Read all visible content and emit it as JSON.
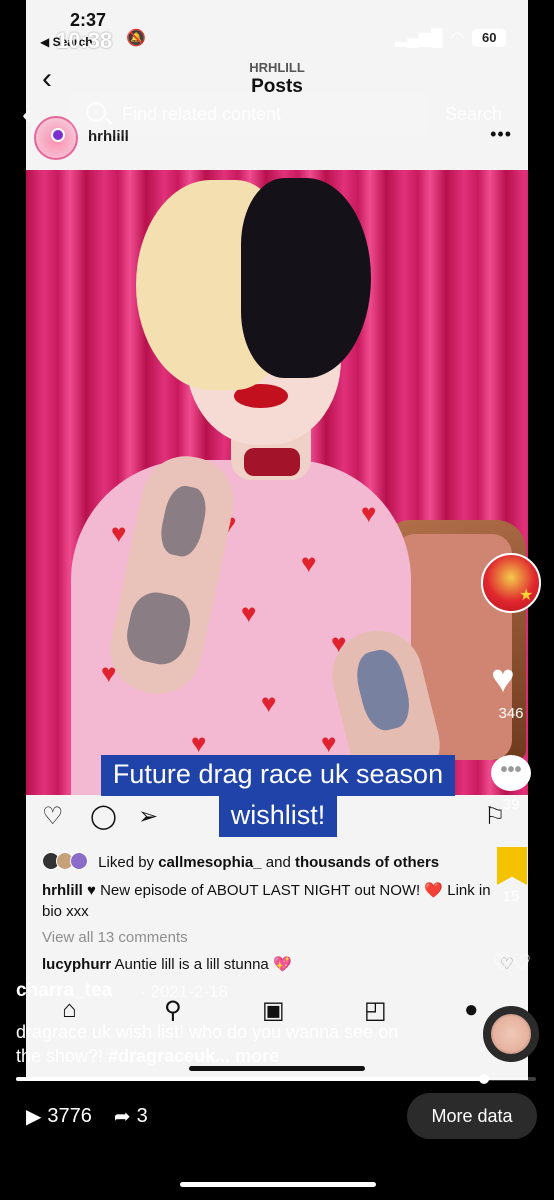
{
  "embedded_screenshot": {
    "status": {
      "time": "2:37",
      "back_label": "◀ Search"
    },
    "header": {
      "account": "HRHLILL",
      "title": "Posts"
    },
    "post": {
      "username": "hrhlill",
      "more_icon": "more-horizontal-icon",
      "liked_by_prefix": "Liked by",
      "liked_by_user": "callmesophia_",
      "liked_by_and": "and",
      "liked_by_others": "thousands of others",
      "caption_user": "hrhlill",
      "caption_text": "♥ New episode of ABOUT LAST NIGHT out NOW! ❤️ Link in bio xxx",
      "view_comments": "View all 13 comments",
      "comment_user": "lucyphurr",
      "comment_text": "Auntie lill is a lill stunna 💖"
    }
  },
  "tiktok": {
    "status": {
      "time": "10:38",
      "battery": "60"
    },
    "search": {
      "placeholder": "Find related content",
      "button": "Search"
    },
    "overlay_title": {
      "line1": "Future drag race uk season",
      "line2": "wishlist!"
    },
    "likes": "346",
    "comments": "39",
    "saves": "15",
    "author": "charra_tea",
    "date": "· 2021-2-18",
    "description": "dragrace uk wish list! who do you wanna see on the show?!",
    "hashtag": "#dragraceuk",
    "ellipsis": "...",
    "more_link": "more",
    "progress": 0.9,
    "views": "3776",
    "shares": "3",
    "more_data_button": "More data",
    "colors": {
      "overlay_bg": "#1f43a8",
      "save_accent": "#f5c200"
    }
  }
}
